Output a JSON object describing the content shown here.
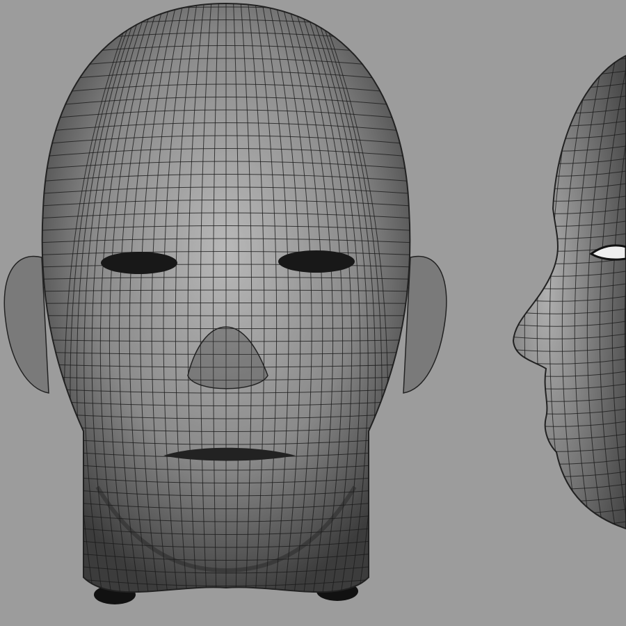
{
  "scene": {
    "background_color": "#9c9c9c",
    "mesh_line_color": "#1a1a1a",
    "skin_light": "#b4b4b4",
    "skin_dark": "#3a3a3a",
    "views": [
      "front-view",
      "side-view"
    ]
  }
}
